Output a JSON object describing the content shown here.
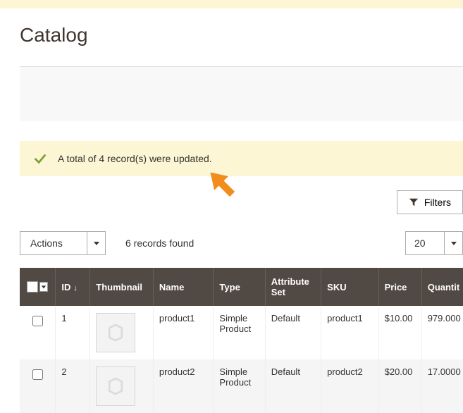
{
  "page": {
    "title": "Catalog"
  },
  "message": {
    "text": "A total of 4 record(s) were updated."
  },
  "filters": {
    "label": "Filters"
  },
  "actions": {
    "label": "Actions"
  },
  "records_found": "6 records found",
  "page_size": "20",
  "columns": {
    "id": "ID",
    "thumbnail": "Thumbnail",
    "name": "Name",
    "type": "Type",
    "attribute_set": "Attribute Set",
    "sku": "SKU",
    "price": "Price",
    "quantity": "Quantit"
  },
  "sort_indicator": "↓",
  "rows": [
    {
      "id": "1",
      "name": "product1",
      "type": "Simple Product",
      "attribute_set": "Default",
      "sku": "product1",
      "price": "$10.00",
      "quantity": "979.000"
    },
    {
      "id": "2",
      "name": "product2",
      "type": "Simple Product",
      "attribute_set": "Default",
      "sku": "product2",
      "price": "$20.00",
      "quantity": "17.0000"
    }
  ]
}
